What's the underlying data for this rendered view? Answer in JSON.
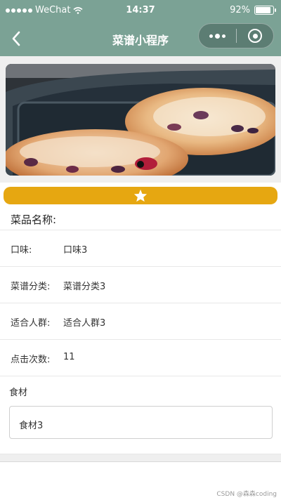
{
  "status_bar": {
    "carrier": "WeChat",
    "time": "14:37",
    "battery": "92%",
    "battery_level": 0.92
  },
  "nav": {
    "title": "菜谱小程序",
    "back_icon": "chevron-left-icon",
    "more_icon": "more-dots-icon",
    "close_icon": "target-circle-icon",
    "bg_color": "#7ba295"
  },
  "favorite": {
    "icon": "star-icon",
    "color": "#e6a711"
  },
  "recipe": {
    "name_label": "菜品名称:",
    "fields": [
      {
        "label": "口味:",
        "value": "口味3"
      },
      {
        "label": "菜谱分类:",
        "value": "菜谱分类3"
      },
      {
        "label": "适合人群:",
        "value": "适合人群3"
      },
      {
        "label": "点击次数:",
        "value": "11"
      }
    ],
    "ingredients_label": "食材",
    "ingredients_value": "食材3"
  },
  "watermark": "CSDN @森森coding"
}
